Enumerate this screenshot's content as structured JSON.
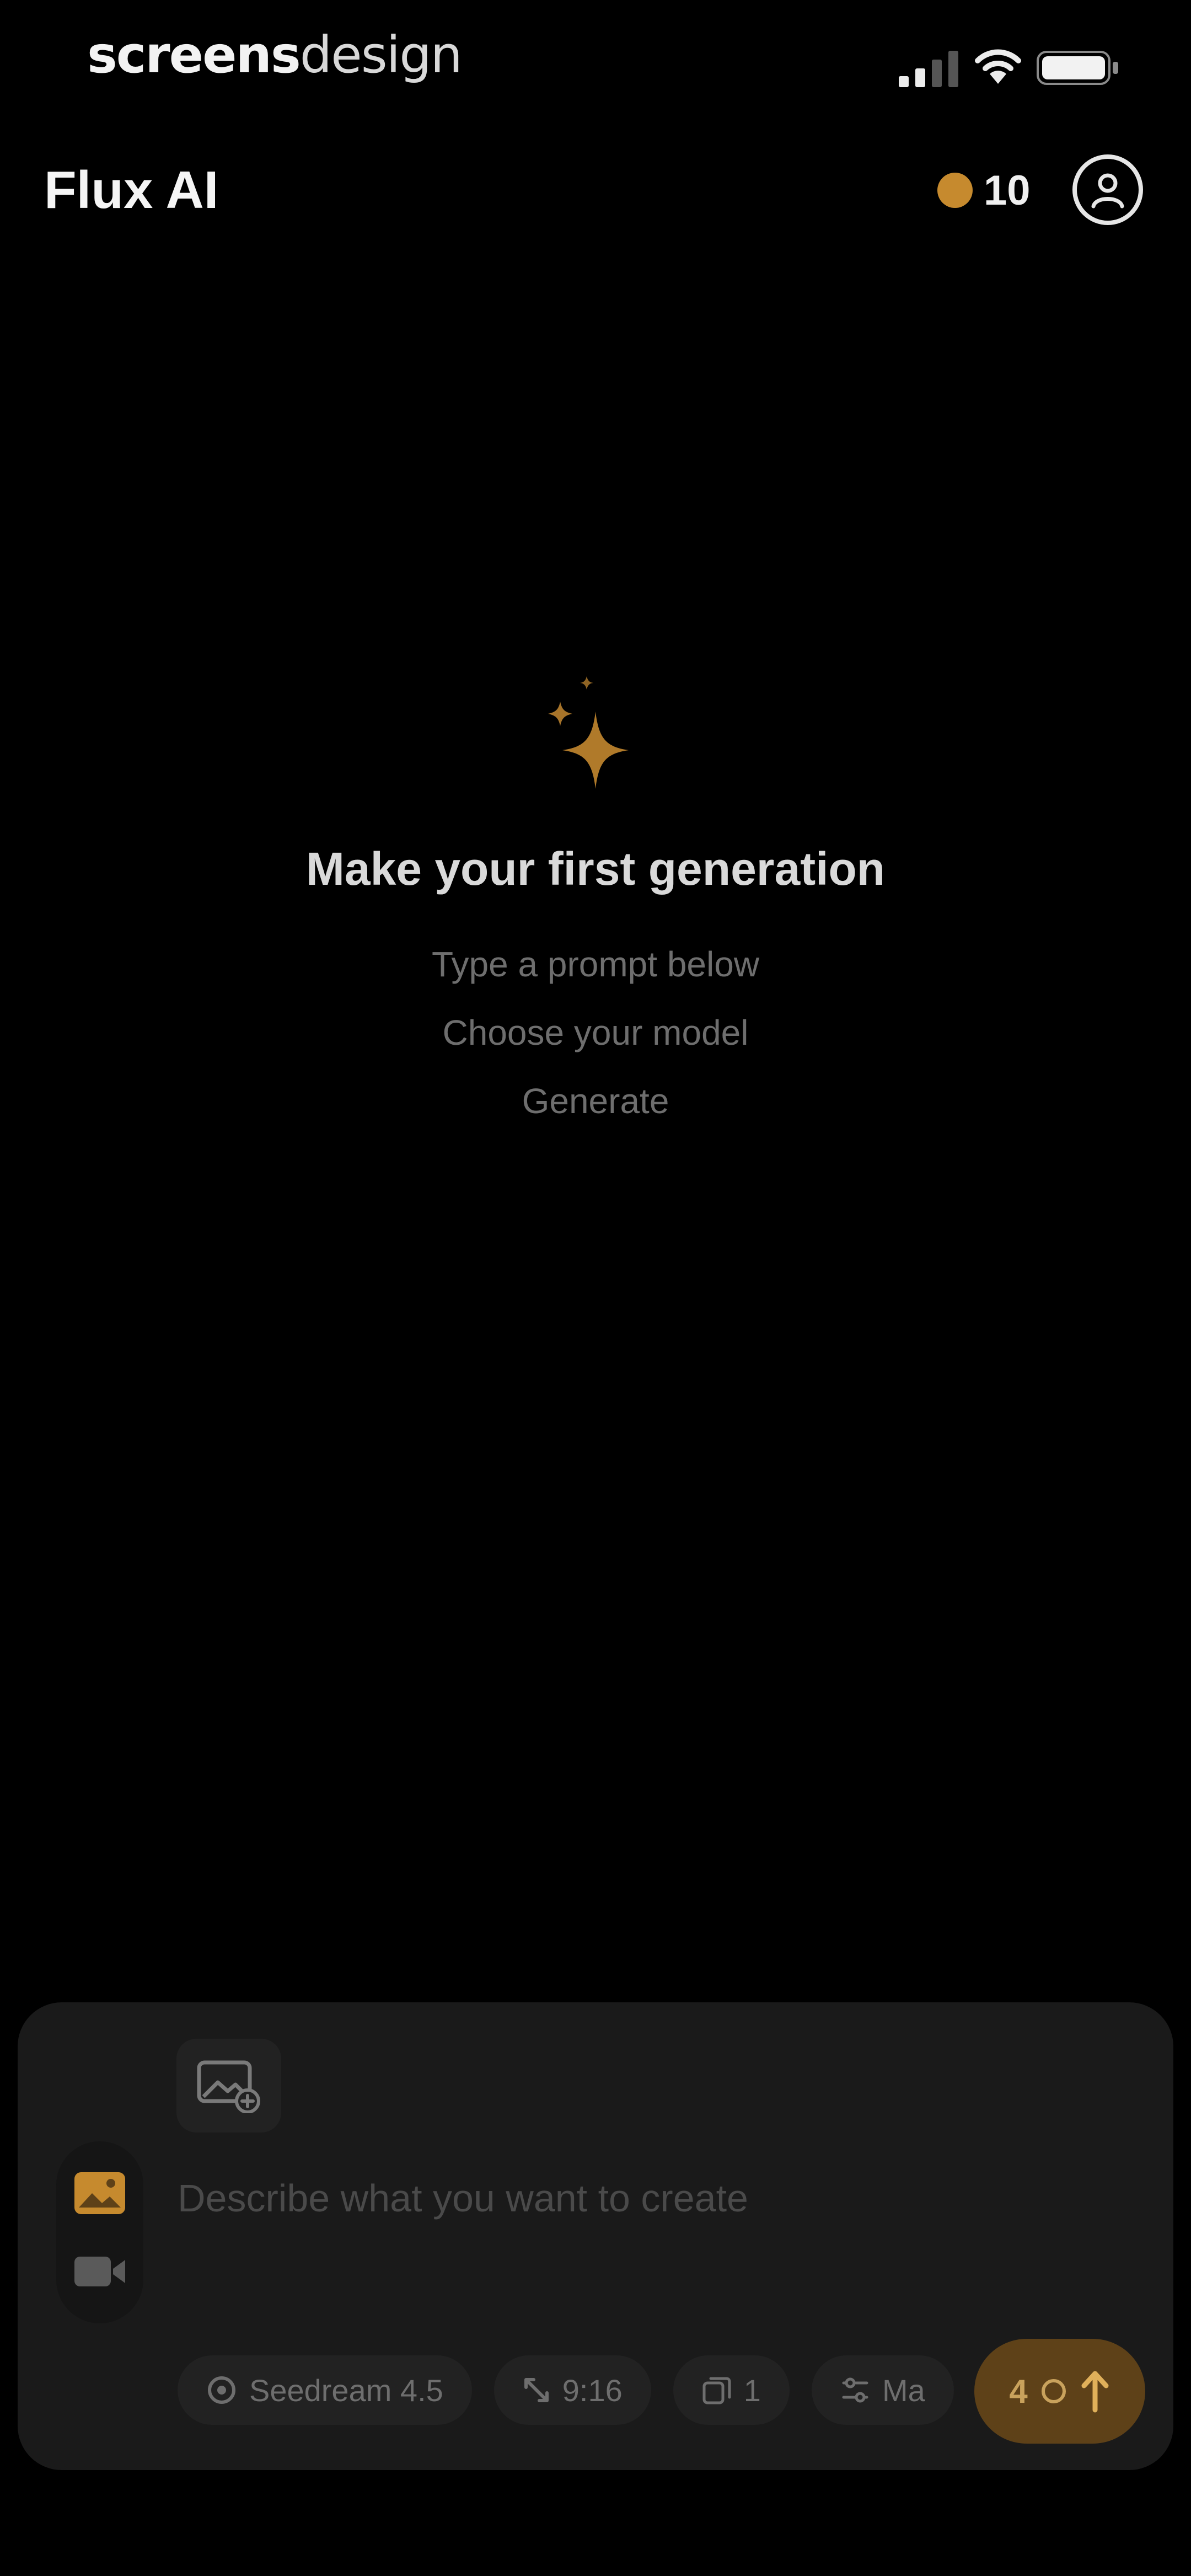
{
  "status_bar": {
    "brand_bold": "screens",
    "brand_light": "design"
  },
  "header": {
    "title": "Flux AI",
    "credits": "10",
    "credit_icon": "coin-icon",
    "profile_icon": "profile-icon"
  },
  "empty_state": {
    "icon": "sparkle-icon",
    "title": "Make your first generation",
    "steps": [
      "Type a prompt below",
      "Choose your model",
      "Generate"
    ]
  },
  "composer": {
    "attach_icon": "image-upload-icon",
    "modes": [
      {
        "name": "image",
        "icon": "image-icon",
        "active": true
      },
      {
        "name": "video",
        "icon": "video-icon",
        "active": false
      }
    ],
    "placeholder": "Describe what you want to create",
    "chips": [
      {
        "label": "Seedream 4.5",
        "icon": "model-icon"
      },
      {
        "label": "9:16",
        "icon": "aspect-ratio-icon"
      },
      {
        "label": "1",
        "icon": "count-icon"
      },
      {
        "label": "Ma",
        "icon": "settings-sliders-icon"
      }
    ],
    "generate_cost": "4",
    "generate_icon": "arrow-up-icon"
  },
  "colors": {
    "background": "#000000",
    "panel": "#1a1a1a",
    "accent": "#c68a2e",
    "generate_button": "#5e4118"
  }
}
